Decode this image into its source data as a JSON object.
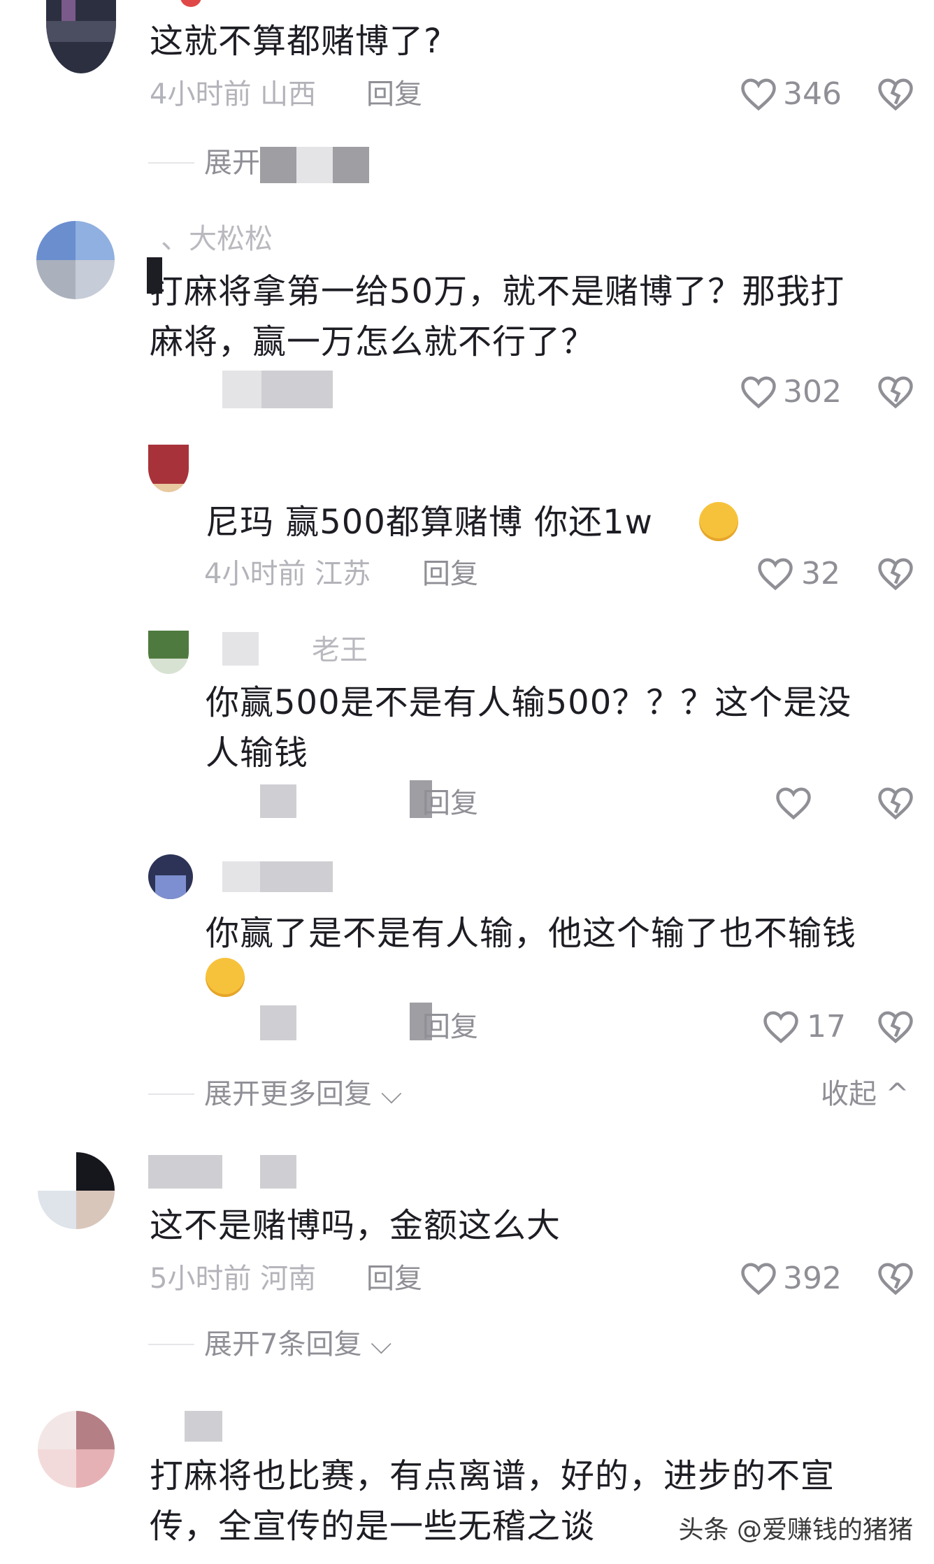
{
  "colors": {
    "background": "#ffffff",
    "text_primary": "#1d1d24",
    "text_meta": "#b3b3ba",
    "text_secondary": "#8f8f96"
  },
  "icons": {
    "like": "heart-outline-icon",
    "dislike": "broken-heart-icon",
    "expand": "chevron-down-icon",
    "collapse": "chevron-up-icon"
  },
  "comments": [
    {
      "text_lines": [
        "这就不算都赌博了?"
      ],
      "meta": "4小时前 山西",
      "reply_label": "回复",
      "likes": "346",
      "expand_label": "展开"
    },
    {
      "username": "、大松松",
      "text_lines": [
        "打麻将拿第一给50万，就不是赌博了？那我打",
        "麻将，赢一万怎么就不行了？"
      ],
      "likes": "302",
      "replies": [
        {
          "text_lines": [
            "尼玛  赢500都算赌博   你还1w"
          ],
          "meta": "4小时前 江苏",
          "reply_label": "回复",
          "likes": "32"
        },
        {
          "username": "老王",
          "text_lines": [
            "你赢500是不是有人输500？？？这个是没",
            "人输钱"
          ],
          "reply_label": "回复",
          "likes": ""
        },
        {
          "text_lines": [
            "你赢了是不是有人输，他这个输了也不输钱"
          ],
          "reply_label": "回复",
          "likes": "17"
        }
      ],
      "expand_label": "展开更多回复",
      "collapse_label": "收起"
    },
    {
      "text_lines": [
        "这不是赌博吗，金额这么大"
      ],
      "meta": "5小时前 河南",
      "reply_label": "回复",
      "likes": "392",
      "expand_label": "展开7条回复"
    },
    {
      "text_lines": [
        "打麻将也比赛，有点离谱，好的，进步的不宣",
        "传，全宣传的是一些无稽之谈"
      ]
    }
  ],
  "watermark": "头条 @爱赚钱的猪猪"
}
